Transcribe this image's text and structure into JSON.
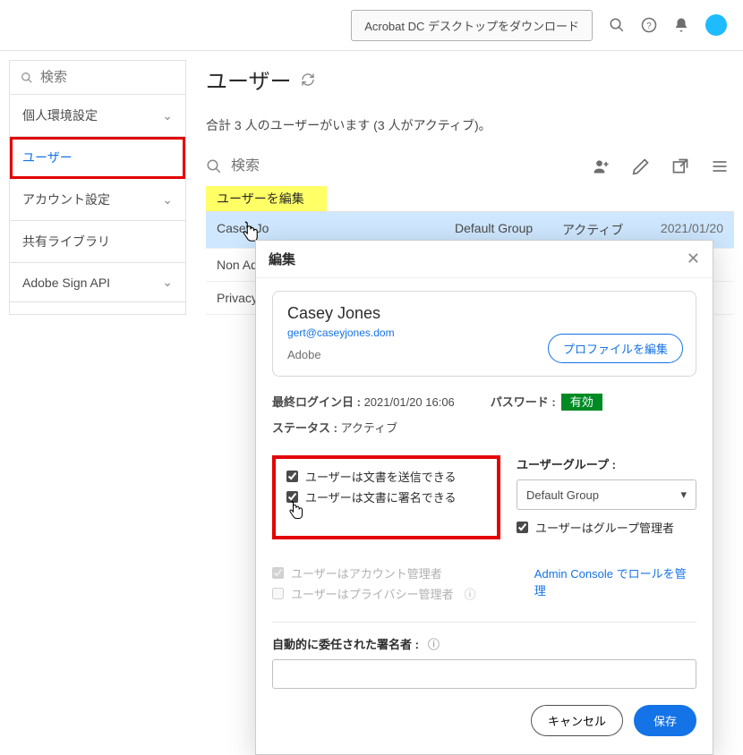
{
  "topbar": {
    "download_label": "Acrobat DC デスクトップをダウンロード"
  },
  "sidebar": {
    "search_placeholder": "検索",
    "items": [
      {
        "label": "個人環境設定",
        "has_caret": true
      },
      {
        "label": "ユーザー",
        "active": true
      },
      {
        "label": "アカウント設定",
        "has_caret": true
      },
      {
        "label": "共有ライブラリ"
      },
      {
        "label": "Adobe Sign API",
        "has_caret": true
      }
    ]
  },
  "main": {
    "title": "ユーザー",
    "summary": "合計 3 人のユーザーがいます (3 人がアクティブ)。",
    "toolbar_search_placeholder": "検索",
    "highlight_label": "ユーザーを編集",
    "rows": [
      {
        "name": "Casey Jo",
        "group": "Default Group",
        "status": "アクティブ",
        "date": "2021/01/20"
      },
      {
        "name": "Non Adm"
      },
      {
        "name": "Privacy A"
      }
    ]
  },
  "modal": {
    "title": "編集",
    "profile": {
      "name": "Casey Jones",
      "email": "gert@caseyjones.dom",
      "company": "Adobe",
      "edit_btn": "プロファイルを編集"
    },
    "last_login_label": "最終ログイン日 :",
    "last_login_value": "2021/01/20 16:06",
    "password_label": "パスワード :",
    "password_value": "有効",
    "status_label": "ステータス :",
    "status_value": "アクティブ",
    "perm_send": "ユーザーは文書を送信できる",
    "perm_sign": "ユーザーは文書に署名できる",
    "group_label": "ユーザーグループ :",
    "group_value": "Default Group",
    "group_admin": "ユーザーはグループ管理者",
    "acct_admin": "ユーザーはアカウント管理者",
    "privacy_admin": "ユーザーはプライバシー管理者",
    "admin_console_link": "Admin Console でロールを管理",
    "auto_signer_label": "自動的に委任された署名者 :",
    "cancel": "キャンセル",
    "save": "保存"
  }
}
